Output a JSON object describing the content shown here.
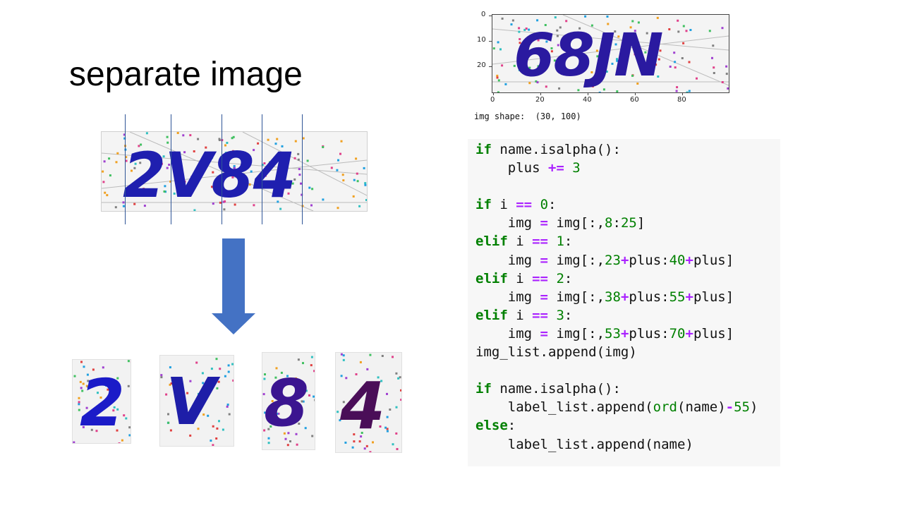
{
  "slide": {
    "title": "separate image"
  },
  "captcha_main": {
    "text": "2V84",
    "colors": [
      "#1f1fbf",
      "#1f1faf",
      "#3a1a90",
      "#4a1060"
    ]
  },
  "pieces": [
    {
      "char": "2",
      "color": "#1b1bc8"
    },
    {
      "char": "V",
      "color": "#1e1ea8"
    },
    {
      "char": "8",
      "color": "#3b1590"
    },
    {
      "char": "4",
      "color": "#4a0e58"
    }
  ],
  "plot": {
    "captcha_text": "68JN",
    "x_ticks": [
      "0",
      "20",
      "40",
      "60",
      "80"
    ],
    "y_ticks": [
      "0",
      "10",
      "20"
    ]
  },
  "shape_output": "img shape:  (30, 100)",
  "code": {
    "lines": [
      "if name.isalpha():",
      "    plus += 3",
      "",
      "if i == 0:",
      "    img = img[:,8:25]",
      "elif i == 1:",
      "    img = img[:,23+plus:40+plus]",
      "elif i == 2:",
      "    img = img[:,38+plus:55+plus]",
      "elif i == 3:",
      "    img = img[:,53+plus:70+plus]",
      "img_list.append(img)",
      "",
      "if name.isalpha():",
      "    label_list.append(ord(name)-55)",
      "else:",
      "    label_list.append(name)"
    ]
  },
  "colors": {
    "arrow": "#4472c4",
    "divider": "#2f5597",
    "code_bg": "#f7f7f7"
  }
}
